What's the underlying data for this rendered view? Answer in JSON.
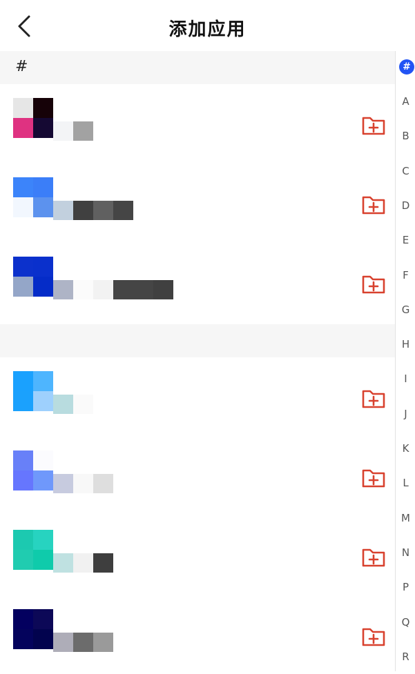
{
  "header": {
    "title": "添加应用",
    "back_icon": "chevron-left-icon"
  },
  "sections": [
    {
      "label": "#"
    },
    {
      "label": ""
    }
  ],
  "index_bar": {
    "active": "#",
    "letters": [
      "A",
      "B",
      "C",
      "D",
      "E",
      "F",
      "G",
      "H",
      "I",
      "J",
      "K",
      "L",
      "M",
      "N",
      "P",
      "Q",
      "R"
    ]
  },
  "apps": [
    {
      "icon_colors": [
        "#e6e6e6",
        "#160208",
        "#df3281",
        "#150933"
      ],
      "name_blocks": [
        "#f3f4f6",
        "#a2a2a2"
      ]
    },
    {
      "icon_colors": [
        "#3c84fa",
        "#3b7ef8",
        "#f2f7fe",
        "#5c92ee"
      ],
      "name_blocks": [
        "#c2d0de",
        "#404040",
        "#606060",
        "#454545"
      ]
    },
    {
      "icon_colors": [
        "#0c31cc",
        "#0a30cc",
        "#94a6c8",
        "#052cc8"
      ],
      "name_blocks": [
        "#aeb4c6",
        "#fbfbfb",
        "#f2f2f2",
        "#454545",
        "#454545",
        "#404040"
      ]
    },
    {
      "icon_colors": [
        "#1aa1fe",
        "#4eb5fe",
        "#1ba1fd",
        "#9ed0fd"
      ],
      "name_blocks": [
        "#b8dcdf",
        "#fafafa"
      ]
    },
    {
      "icon_colors": [
        "#6880f8",
        "#fbfbfe",
        "#6676fe",
        "#6f98fb"
      ],
      "name_blocks": [
        "#c7cbdf",
        "#f8f8f8",
        "#dedede"
      ]
    },
    {
      "icon_colors": [
        "#1cc9b0",
        "#27d3c0",
        "#20ccb0",
        "#0fcbab"
      ],
      "name_blocks": [
        "#bfe1e1",
        "#f1f1f1",
        "#3e3e3e"
      ]
    },
    {
      "icon_colors": [
        "#03005f",
        "#0c0857",
        "#04035c",
        "#02034e"
      ],
      "name_blocks": [
        "#aeadb8",
        "#6c6c6c",
        "#9a9a9a"
      ]
    }
  ],
  "colors": {
    "accent": "#d8412e",
    "index_active": "#2254f4"
  }
}
